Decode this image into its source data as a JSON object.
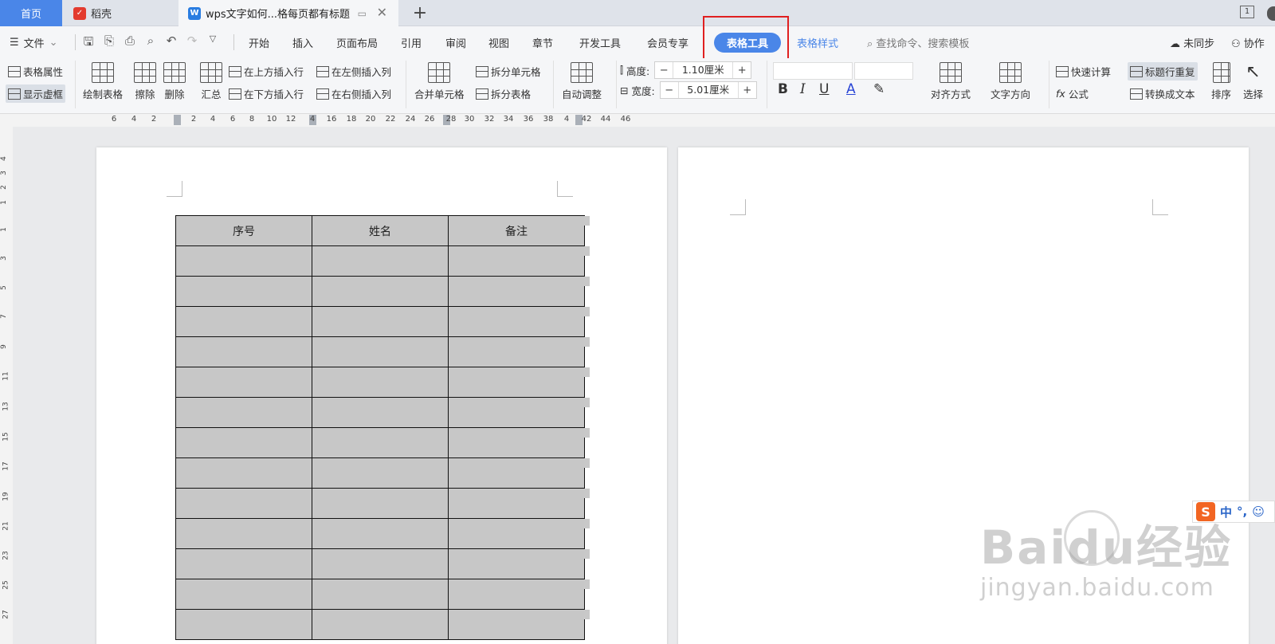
{
  "tabs": {
    "home": "首页",
    "daoke": "稻壳",
    "document": "wps文字如何...格每页都有标题",
    "add": "+"
  },
  "menu": {
    "file": "文件",
    "items": [
      "开始",
      "插入",
      "页面布局",
      "引用",
      "审阅",
      "视图",
      "章节",
      "开发工具",
      "会员专享"
    ],
    "active": "表格工具",
    "style_tab": "表格样式",
    "search_placeholder": "查找命令、搜索模板",
    "sync": "未同步",
    "collab": "协作"
  },
  "ribbon": {
    "table_props": "表格属性",
    "show_gridlines": "显示虚框",
    "draw_table": "绘制表格",
    "erase": "擦除",
    "delete": "删除",
    "summary": "汇总",
    "insert_above": "在上方插入行",
    "insert_below": "在下方插入行",
    "insert_left": "在左侧插入列",
    "insert_right": "在右侧插入列",
    "merge_cells": "合并单元格",
    "split_cells": "拆分单元格",
    "split_table": "拆分表格",
    "auto_adjust": "自动调整",
    "height_label": "高度:",
    "height_value": "1.10厘米",
    "width_label": "宽度:",
    "width_value": "5.01厘米",
    "align": "对齐方式",
    "text_direction": "文字方向",
    "quick_calc": "快速计算",
    "formula": "公式",
    "repeat_header": "标题行重复",
    "convert_text": "转换成文本",
    "sort": "排序",
    "select": "选择"
  },
  "hruler_labels": [
    "6",
    "4",
    "2",
    "2",
    "4",
    "6",
    "8",
    "10",
    "12",
    "4",
    "16",
    "18",
    "20",
    "22",
    "24",
    "26",
    "28",
    "30",
    "32",
    "34",
    "36",
    "38",
    "4",
    "42",
    "44",
    "46"
  ],
  "vruler_labels": [
    "4",
    "3",
    "2",
    "1",
    "1",
    "3",
    "5",
    "7",
    "9",
    "11",
    "13",
    "15",
    "17",
    "19",
    "21",
    "23",
    "25",
    "27"
  ],
  "table": {
    "headers": [
      "序号",
      "姓名",
      "备注"
    ],
    "empty_rows": 13
  },
  "ime": {
    "mode": "中",
    "punct": "°,"
  },
  "watermark": {
    "line1": "Baidu经验",
    "line2": "jingyan.baidu.com"
  },
  "colors": {
    "accent": "#4a86e8",
    "highlight": "#e02020",
    "cell_fill": "#c7c7c7"
  }
}
